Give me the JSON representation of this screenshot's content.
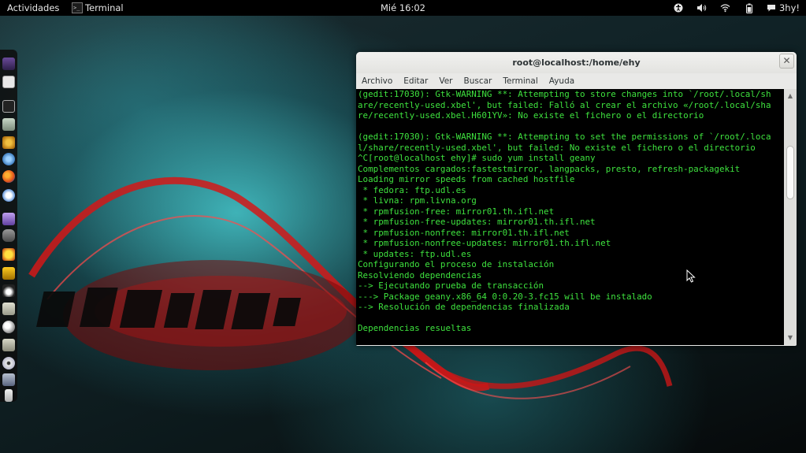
{
  "topbar": {
    "activities": "Actividades",
    "app_name": "Terminal",
    "app_icon_glyph": ">_",
    "clock": "Mié 16:02",
    "user": "3hy!",
    "status_icons": [
      "accessibility-icon",
      "volume-icon",
      "wifi-icon",
      "battery-icon"
    ]
  },
  "dock": {
    "items": [
      "app-launcher-icon",
      "text-editor-icon",
      "terminal-icon",
      "calculator-icon",
      "tool-icon",
      "network-icon",
      "firefox-icon",
      "chat-icon",
      "messenger-icon",
      "pidgin-icon",
      "pacman-icon",
      "crossword-icon",
      "penguin-icon",
      "folder-icon",
      "search-icon",
      "folder-icon",
      "disc-icon",
      "window-icon",
      "usb-icon"
    ]
  },
  "window": {
    "title": "root@localhost:/home/ehy",
    "close_glyph": "✕",
    "menu": [
      "Archivo",
      "Editar",
      "Ver",
      "Buscar",
      "Terminal",
      "Ayuda"
    ],
    "terminal_lines": [
      "(gedit:17030): Gtk-WARNING **: Attempting to store changes into `/root/.local/sh",
      "are/recently-used.xbel', but failed: Falló al crear el archivo «/root/.local/sha",
      "re/recently-used.xbel.H601YV»: No existe el fichero o el directorio",
      "",
      "(gedit:17030): Gtk-WARNING **: Attempting to set the permissions of `/root/.loca",
      "l/share/recently-used.xbel', but failed: No existe el fichero o el directorio",
      "^C[root@localhost ehy]# sudo yum install geany",
      "Complementos cargados:fastestmirror, langpacks, presto, refresh-packagekit",
      "Loading mirror speeds from cached hostfile",
      " * fedora: ftp.udl.es",
      " * livna: rpm.livna.org",
      " * rpmfusion-free: mirror01.th.ifl.net",
      " * rpmfusion-free-updates: mirror01.th.ifl.net",
      " * rpmfusion-nonfree: mirror01.th.ifl.net",
      " * rpmfusion-nonfree-updates: mirror01.th.ifl.net",
      " * updates: ftp.udl.es",
      "Configurando el proceso de instalación",
      "Resolviendo dependencias",
      "--> Ejecutando prueba de transacción",
      "---> Package geany.x86_64 0:0.20-3.fc15 will be instalado",
      "--> Resolución de dependencias finalizada",
      "",
      "Dependencias resueltas"
    ],
    "colors": {
      "terminal_bg": "#000000",
      "terminal_fg": "#3ee13e"
    }
  }
}
